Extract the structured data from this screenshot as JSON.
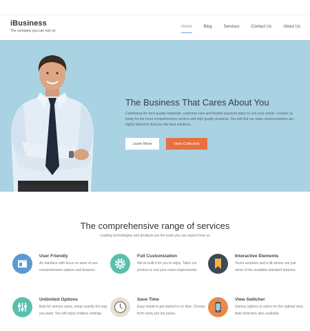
{
  "header": {
    "brand": "iBusiness",
    "tagline": "The company you can rely on",
    "nav": [
      "Home",
      "Blog",
      "Services",
      "Contact Us",
      "About Us"
    ]
  },
  "hero": {
    "title": "The Business That Cares About You",
    "text": "Combining the best quality materials, customer care and flexible payment plans to suit your needs. Contact us today for the most comprehensive service and high quality products. You will find our sales representatives are highly trained to find you the best solutions.",
    "learn_more": "Learn More",
    "view_collection": "View Collection",
    "colors": {
      "background": "#a9d2e3",
      "accent": "#e8703e"
    }
  },
  "services": {
    "title": "The comprehensive range of services",
    "subtitle": "Leading technologies and products are the least you can expect from us",
    "items": [
      {
        "icon": "browser-window-icon",
        "color": "#5b9bd1",
        "title": "User Friendly",
        "desc": "An interface with focus on ease of use, comprehensive options and features."
      },
      {
        "icon": "gear-icon",
        "color": "#5bbfad",
        "title": "Full Customization",
        "desc": "We've built it for you to enjoy. Tailor our product to suit your exact requirements."
      },
      {
        "icon": "bookmark-icon",
        "color": "#3c4a5a",
        "title": "Interactive Elements",
        "desc": "Touch sensitive and a tilt sensor are just some of the available standard features."
      },
      {
        "icon": "sliders-icon",
        "color": "#5bbfad",
        "title": "Unlimited Options",
        "desc": "Built for serious users, setup exactly the way you want. You will enjoy endless settings."
      },
      {
        "icon": "clock-icon",
        "color": "#e6e0d4",
        "title": "Save Time",
        "desc": "Easy install to get started in no time. Choose from many pre-set packs."
      },
      {
        "icon": "phone-icon",
        "color": "#e98a4a",
        "title": "View Switcher",
        "desc": "Various options to select for the optimal view. Auto detection also available."
      }
    ]
  }
}
